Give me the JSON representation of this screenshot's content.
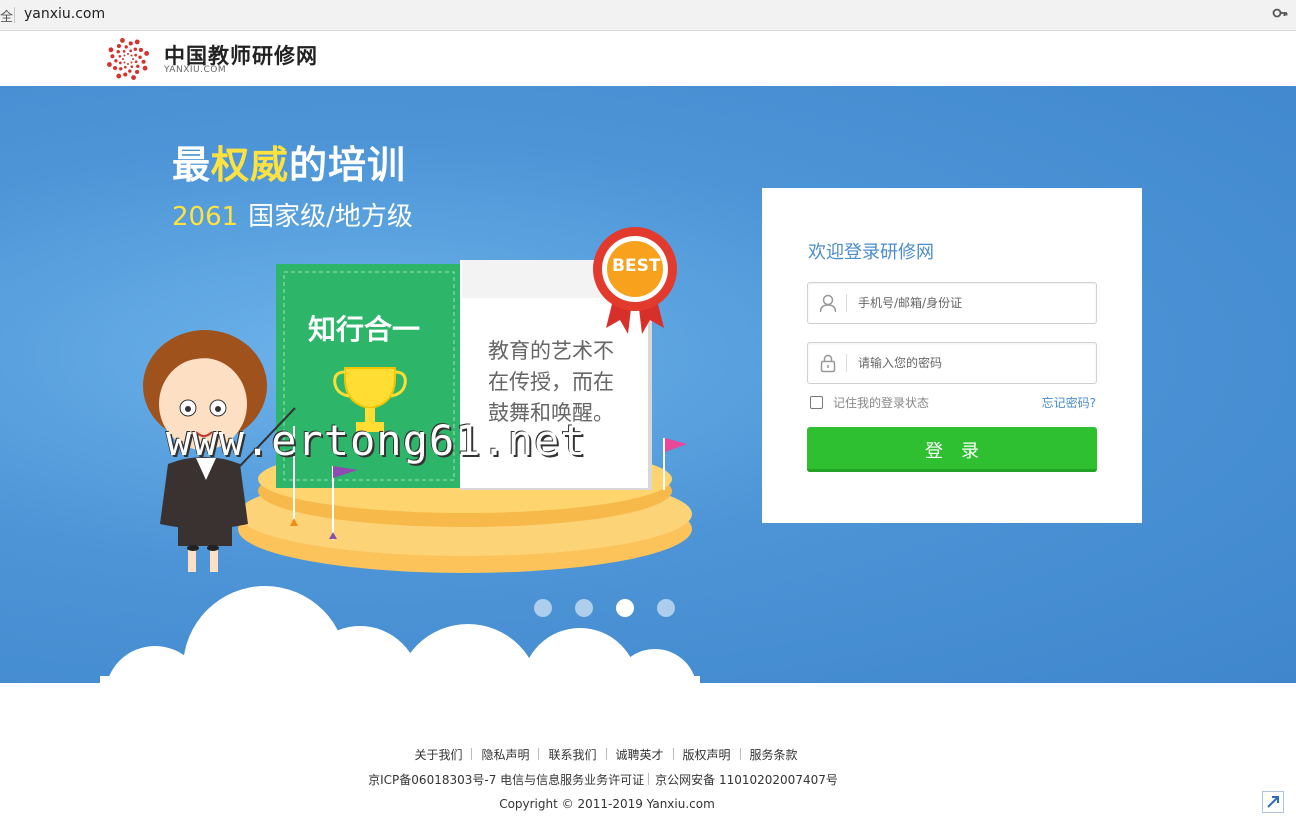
{
  "browser": {
    "security_label": "全",
    "url": "yanxiu.com",
    "key_icon": "key-icon"
  },
  "header": {
    "brand_name": "中国教师研修网",
    "brand_sub": "YANXIU.COM",
    "logo_icon": "spiral-dots-logo"
  },
  "hero": {
    "title_prefix": "最",
    "title_highlight": "权威",
    "title_suffix": "的培训",
    "sub_number": "2061",
    "sub_text": "国家级/地方级",
    "book_left_title": "知行合一",
    "book_right_text": "教育的艺术不在传授，而在鼓舞和唤醒。",
    "badge_text": "BEST",
    "watermark": "www.ertong61.net",
    "carousel_count": 4,
    "carousel_active": 3
  },
  "login": {
    "title": "欢迎登录研修网",
    "username_placeholder": "手机号/邮箱/身份证",
    "password_placeholder": "请输入您的密码",
    "remember_label": "记住我的登录状态",
    "forgot_label": "忘记密码?",
    "submit_label": "登录",
    "accent_color": "#2fc032",
    "link_color": "#4a8ccc"
  },
  "footer": {
    "links": [
      "关于我们",
      "隐私声明",
      "联系我们",
      "诚聘英才",
      "版权声明",
      "服务条款"
    ],
    "icp_left": "京ICP备06018303号-7 电信与信息服务业务许可证",
    "icp_right": "京公网安备 11010202007407号",
    "copyright": "Copyright © 2011-2019 Yanxiu.com"
  }
}
